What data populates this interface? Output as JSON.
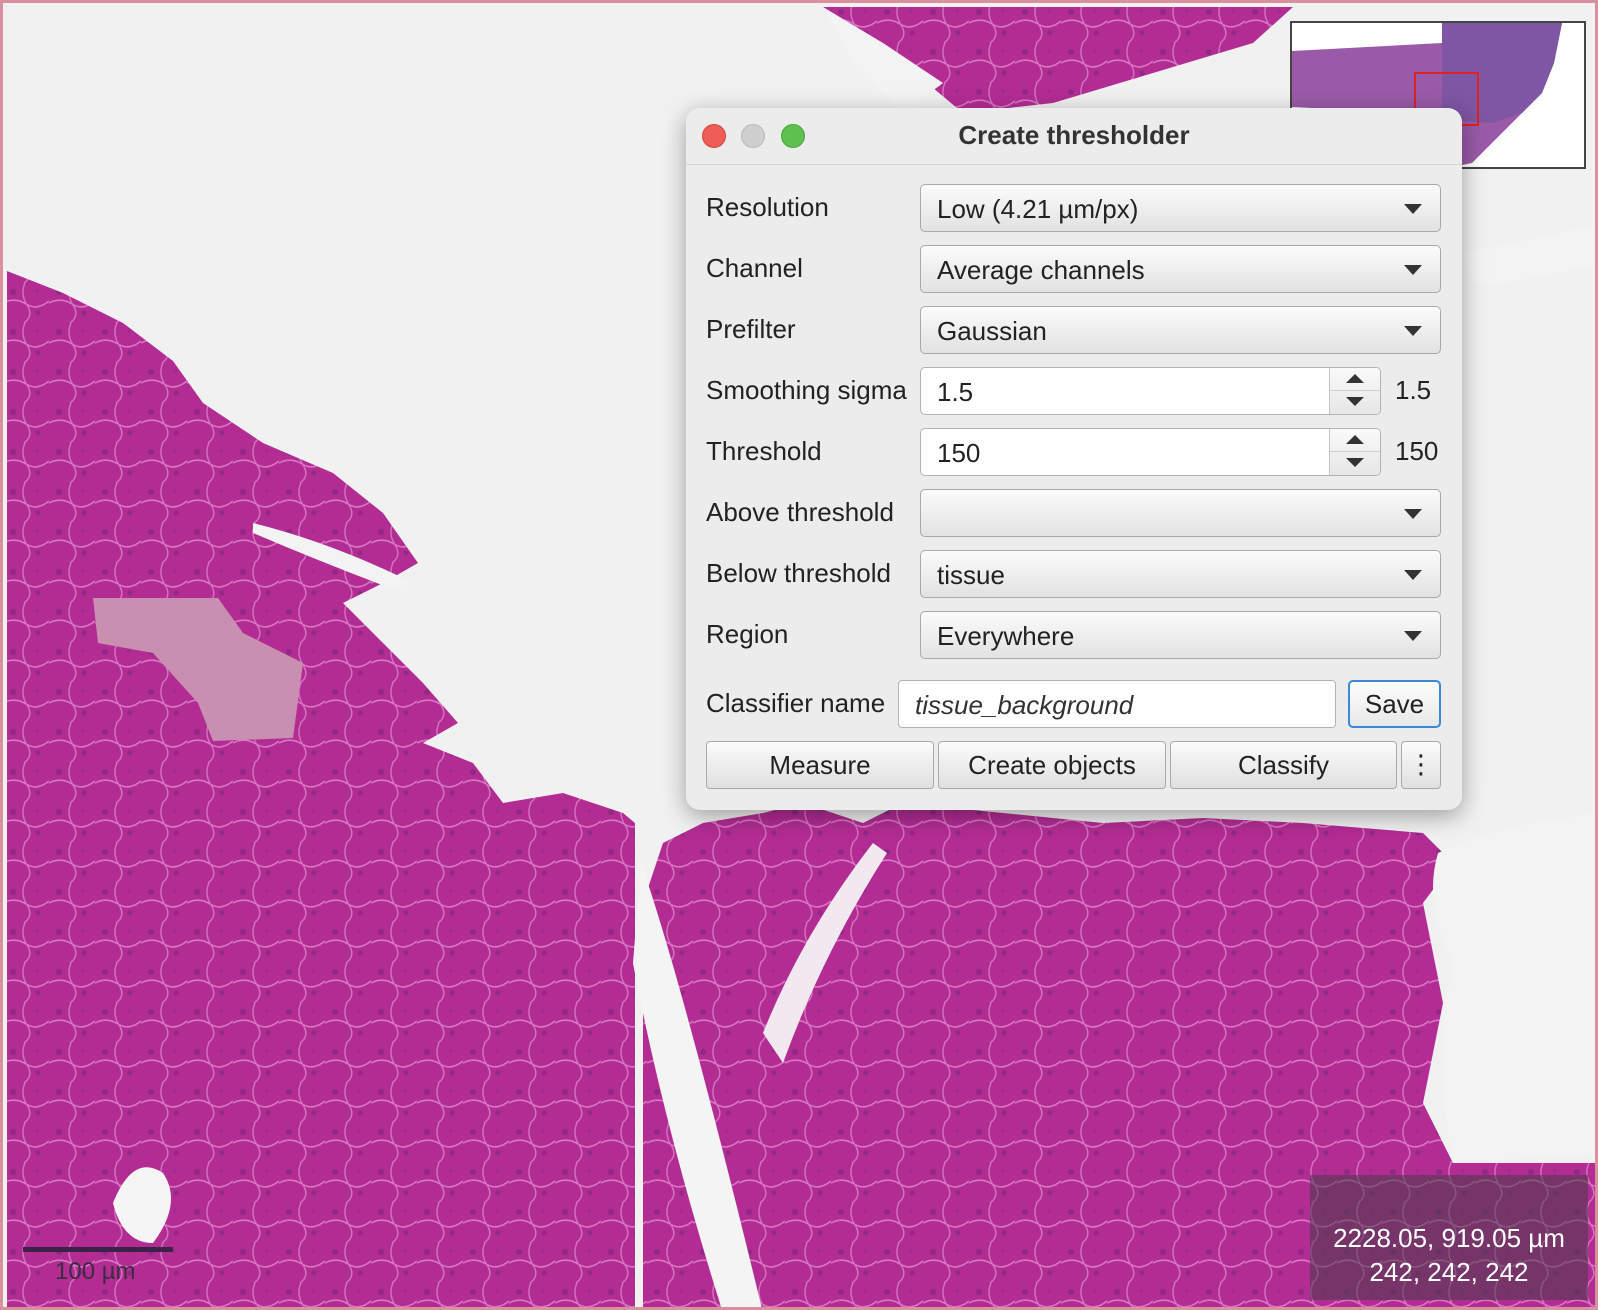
{
  "dialog": {
    "title": "Create thresholder",
    "rows": {
      "resolution": {
        "label": "Resolution",
        "value": "Low (4.21 µm/px)"
      },
      "channel": {
        "label": "Channel",
        "value": "Average channels"
      },
      "prefilter": {
        "label": "Prefilter",
        "value": "Gaussian"
      },
      "smoothing": {
        "label": "Smoothing sigma",
        "value": "1.5",
        "readout": "1.5"
      },
      "threshold": {
        "label": "Threshold",
        "value": "150",
        "readout": "150"
      },
      "above": {
        "label": "Above threshold",
        "value": ""
      },
      "below": {
        "label": "Below threshold",
        "value": "tissue"
      },
      "region": {
        "label": "Region",
        "value": "Everywhere"
      }
    },
    "classifier": {
      "label": "Classifier name",
      "value": "tissue_background",
      "save_label": "Save"
    },
    "actions": {
      "measure": "Measure",
      "create_objects": "Create objects",
      "classify": "Classify",
      "more": "⋮"
    }
  },
  "viewer": {
    "scale_bar_label": "100 µm",
    "cursor_position": "2228.05, 919.05 µm",
    "pixel_value": "242, 242, 242"
  },
  "colors": {
    "tissue": "#b42c96",
    "background": "#f1f1f1",
    "close": "#ee5e57",
    "minimize": "#cfcfcf",
    "zoom": "#5ec14f",
    "focus": "#3a8ad8"
  },
  "icons": [
    "close-button",
    "minimize-button",
    "zoom-button",
    "chevron-down-icon",
    "spin-up-icon",
    "spin-down-icon",
    "more-vertical-icon"
  ]
}
